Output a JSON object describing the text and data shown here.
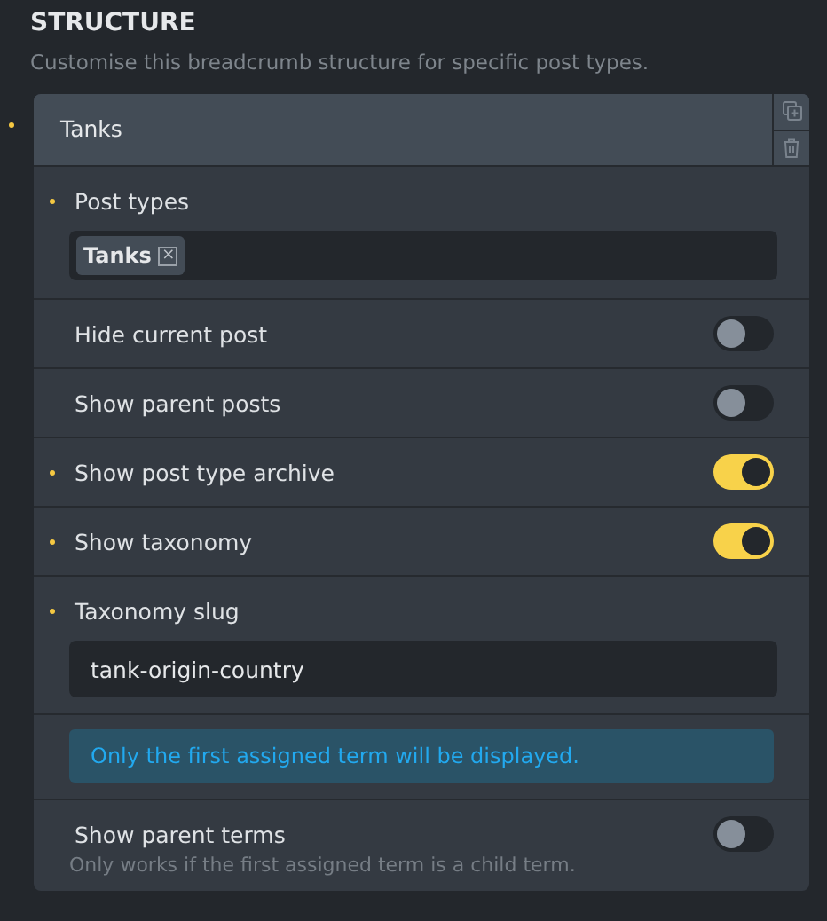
{
  "section": {
    "title": "STRUCTURE",
    "description": "Customise this breadcrumb structure for specific post types."
  },
  "item": {
    "title": "Tanks",
    "changed": true,
    "rows": [
      {
        "kind": "tags",
        "label": "Post types",
        "changed": true,
        "tags": [
          {
            "label": "Tanks",
            "remove": "×"
          }
        ]
      },
      {
        "kind": "toggle",
        "label": "Hide current post",
        "changed": false,
        "on": false
      },
      {
        "kind": "toggle",
        "label": "Show parent posts",
        "changed": false,
        "on": false
      },
      {
        "kind": "toggle",
        "label": "Show post type archive",
        "changed": true,
        "on": true
      },
      {
        "kind": "toggle",
        "label": "Show taxonomy",
        "changed": true,
        "on": true
      },
      {
        "kind": "text",
        "label": "Taxonomy slug",
        "changed": true,
        "value": "tank-origin-country"
      },
      {
        "kind": "notice",
        "text": "Only the first assigned term will be displayed."
      },
      {
        "kind": "toggle",
        "label": "Show parent terms",
        "changed": false,
        "on": false,
        "hint": "Only works if the first assigned term is a child term."
      }
    ]
  }
}
